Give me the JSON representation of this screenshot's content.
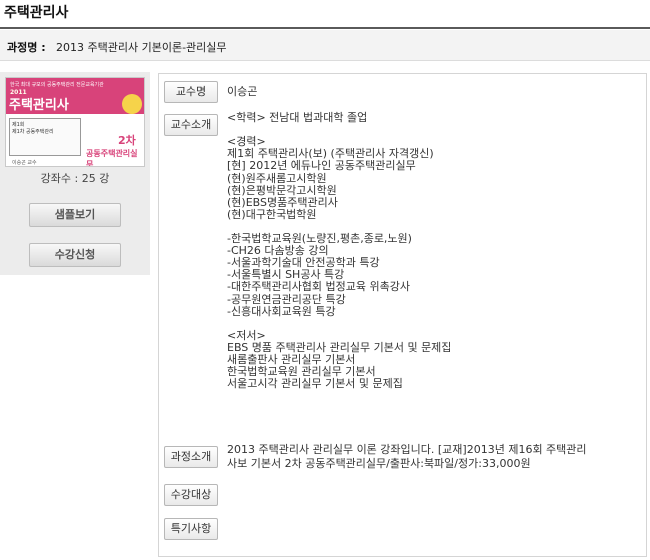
{
  "page": {
    "title": "주택관리사",
    "course_label": "과정명 :",
    "course_name": "2013 주택관리사 기본이론-관리실무"
  },
  "book": {
    "tagline": "한국 최대 규모의 공동주택관리 전문교육기관",
    "year": "2011",
    "title": "주택관리사",
    "line1": "제1회",
    "line2": "제1차 공동주택관리",
    "author": "이승곤 교수",
    "volume": "2차",
    "subtitle": "공동주택관리실무"
  },
  "left_panel": {
    "lecture_count": "강좌수 : 25 강",
    "sample_button": "샘플보기",
    "enroll_button": "수강신청"
  },
  "details": {
    "professor_label": "교수명",
    "professor_name": "이승곤",
    "intro_label": "교수소개",
    "intro_lines": [
      "<학력> 전남대 법과대학 졸업",
      "",
      "<경력>",
      "제1회 주택관리사(보) (주택관리사 자격갱신)",
      "[현] 2012년 에듀나인 공동주택관리실무",
      "(현)원주새롬고시학원",
      "(현)은평박문각고시학원",
      "(현)EBS명품주택관리사",
      "(현)대구한국법학원",
      "",
      "-한국법학교육원(노량진,평촌,종로,노원)",
      "-CH26 다솜방송 강의",
      "-서울과학기술대 안전공학과 특강",
      "-서울특별시 SH공사 특강",
      "-대한주택관리사협회 법정교육 위촉강사",
      "-공무원연금관리공단 특강",
      "-신흥대사회교육원 특강",
      "",
      "<저서>",
      "EBS 명품 주택관리사 관리실무 기본서 및 문제집",
      "새롬출판사 관리실무 기본서",
      "한국법학교육원 관리실무 기본서",
      "서울고시각 관리실무 기본서 및 문제집"
    ],
    "course_intro_label": "과정소개",
    "course_intro_lines": [
      "2013 주택관리사 관리실무 이론 강좌입니다. [교재]2013년 제16회 주택관리",
      "사보 기본서 2차 공동주택관리실무/출판사:북파일/정가:33,000원"
    ],
    "target_label": "수강대상",
    "special_label": "특기사항"
  },
  "colors": {
    "book_accent": "#d8437a",
    "panel_bg": "#ececec",
    "title_rule": "#5a5a5a"
  }
}
